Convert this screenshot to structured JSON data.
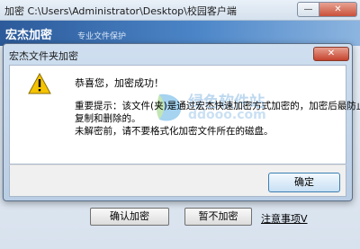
{
  "outer_window": {
    "title": "加密 C:\\Users\\Administrator\\Desktop\\校园客户端",
    "minimize_glyph": "—",
    "close_glyph": "✕",
    "banner_title": "宏杰加密",
    "banner_subtitle": "专业文件保护"
  },
  "outer_buttons": {
    "confirm_label": "确认加密",
    "no_encrypt_label": "暂不加密",
    "notes_label": "注意事项V"
  },
  "dialog": {
    "title": "宏杰文件夹加密",
    "close_glyph": "✕",
    "icon": "warning-triangle-icon",
    "message_title": "恭喜您，加密成功！",
    "message_lines": [
      "重要提示：该文件(夹)是通过宏杰快速加密方式加密的，加密后最防止",
      "复制和删除的。",
      "未解密前，请不要格式化加密文件所在的磁盘。"
    ],
    "ok_label": "确定"
  },
  "watermark": {
    "text": "绿色软件站",
    "url": "ddooo.com"
  },
  "colors": {
    "banner": "#3a6fb0",
    "close_button": "#c9503a",
    "warning_yellow": "#f5c400"
  }
}
